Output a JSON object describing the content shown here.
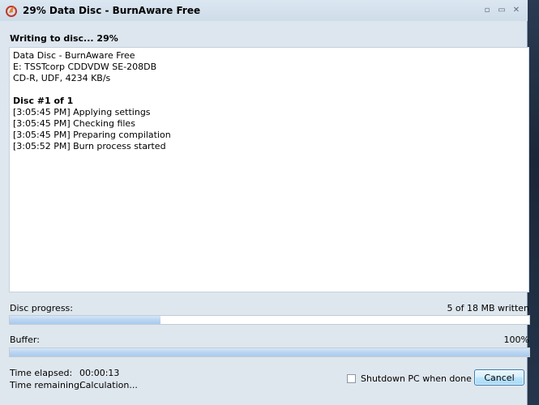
{
  "window": {
    "title": "29% Data Disc - BurnAware Free",
    "minimize_glyph": "▫",
    "restore_glyph": "▭",
    "close_glyph": "✕"
  },
  "status": {
    "heading": "Writing to disc... 29%"
  },
  "log": {
    "lines": [
      "Data Disc - BurnAware Free",
      "E: TSSTcorp CDDVDW SE-208DB",
      "CD-R, UDF, 4234 KB/s",
      "",
      "Disc #1 of 1",
      "[3:05:45 PM] Applying settings",
      "[3:05:45 PM] Checking files",
      "[3:05:45 PM] Preparing compilation",
      "[3:05:52 PM] Burn process started"
    ]
  },
  "disc_progress": {
    "label": "Disc progress:",
    "text": "5 of 18 MB written",
    "fraction": 0.29
  },
  "buffer": {
    "label": "Buffer:",
    "text": "100%",
    "fraction": 1.0
  },
  "time": {
    "elapsed_label": "Time elapsed:",
    "elapsed_value": "00:00:13",
    "remaining_label": "Time remaining:",
    "remaining_value": "Calculation..."
  },
  "shutdown": {
    "label": "Shutdown PC when done",
    "checked": false
  },
  "buttons": {
    "cancel": "Cancel"
  },
  "colors": {
    "accent": "#3c7fb1",
    "progress_fill": "#bcd6f2"
  }
}
